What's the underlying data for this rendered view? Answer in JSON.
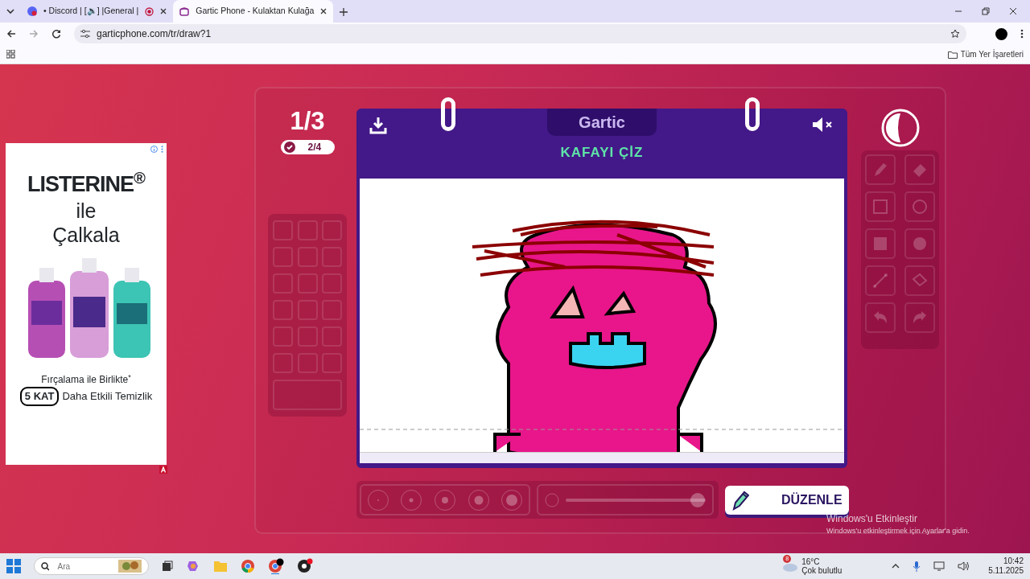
{
  "browser": {
    "tabs": [
      {
        "title": "• Discord | [🔉] |General |",
        "kind": "discord",
        "selected": false
      },
      {
        "title": "Gartic Phone - Kulaktan Kulağa",
        "kind": "gartic",
        "selected": true
      }
    ],
    "address": "garticphone.com/tr/draw?1",
    "bookmarks": "Tüm Yer İşaretleri"
  },
  "ad": {
    "headline": "LISTERINE$^{®}$",
    "line_1": "ile",
    "line_2": "Çalkala",
    "tagline": "Fırçalama ile Birlikte$^{*}$",
    "badge": "5 KAT",
    "claim": "Daha Etkili Temizlik"
  },
  "game": {
    "round": "1/3",
    "done": "2/4",
    "logo": "Gartic",
    "task": "KAFAYI ÇİZ",
    "edit_button": "DÜZENLE",
    "size_slider": {
      "level": 1
    }
  },
  "activation": {
    "title": "Windows'u Etkinleştir",
    "text": "Windows'u etkinleştirmek için Ayarlar'a gidin."
  },
  "taskbar": {
    "search_placeholder": "Ara",
    "weather_badge": "8",
    "temperature": "16°C",
    "weather": "Çok bulutlu",
    "time": "10:42",
    "date": "5.11.2025"
  }
}
